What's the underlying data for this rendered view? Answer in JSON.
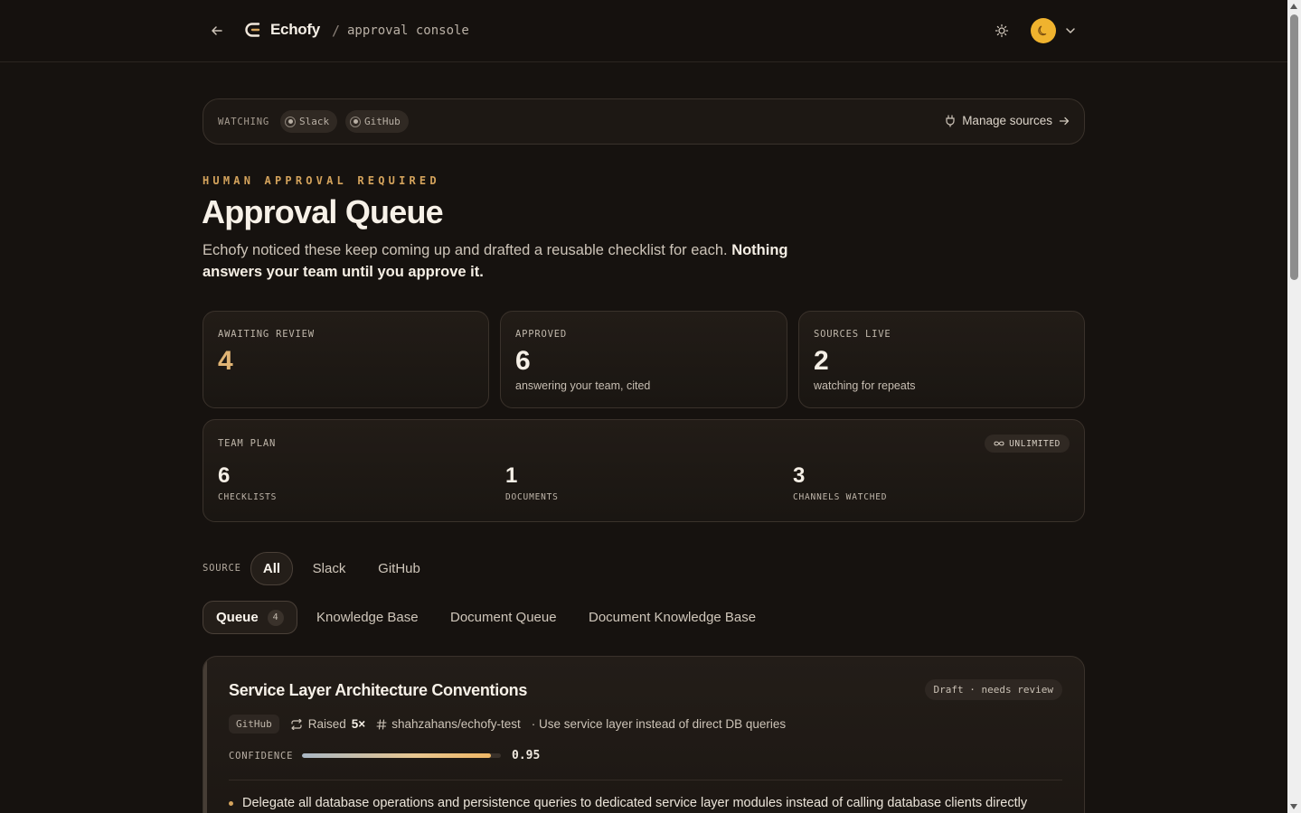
{
  "header": {
    "brand": "Echofy",
    "separator": "/",
    "crumb": "approval console"
  },
  "watching": {
    "label": "WATCHING",
    "sources": [
      "Slack",
      "GitHub"
    ],
    "manage_label": "Manage sources"
  },
  "hero": {
    "eyebrow": "HUMAN APPROVAL REQUIRED",
    "title": "Approval Queue",
    "subtitle_plain": "Echofy noticed these keep coming up and drafted a reusable checklist for each. ",
    "subtitle_bold": "Nothing answers your team until you approve it."
  },
  "stats": [
    {
      "label": "AWAITING REVIEW",
      "value": "4",
      "sub": ""
    },
    {
      "label": "APPROVED",
      "value": "6",
      "sub": "answering your team, cited"
    },
    {
      "label": "SOURCES LIVE",
      "value": "2",
      "sub": "watching for repeats"
    }
  ],
  "plan": {
    "label": "TEAM PLAN",
    "badge": "UNLIMITED",
    "items": [
      {
        "value": "6",
        "caption": "CHECKLISTS"
      },
      {
        "value": "1",
        "caption": "DOCUMENTS"
      },
      {
        "value": "3",
        "caption": "CHANNELS WATCHED"
      }
    ]
  },
  "source_filter": {
    "label": "SOURCE",
    "options": [
      "All",
      "Slack",
      "GitHub"
    ],
    "selected": "All"
  },
  "tabs": {
    "items": [
      "Queue",
      "Knowledge Base",
      "Document Queue",
      "Document Knowledge Base"
    ],
    "queue_count": "4",
    "selected": "Queue"
  },
  "queue_item": {
    "title": "Service Layer Architecture Conventions",
    "status": "Draft · needs review",
    "source": "GitHub",
    "raised_label": "Raised",
    "raised_count": "5×",
    "repo": "shahzahans/echofy-test",
    "summary": "· Use service layer instead of direct DB queries",
    "confidence_label": "CONFIDENCE",
    "confidence": 0.95,
    "confidence_text": "0.95",
    "bullet": "Delegate all database operations and persistence queries to dedicated service layer modules instead of calling database clients directly"
  },
  "colors": {
    "background": "#16120f",
    "accent": "#d4a35c",
    "avatar": "#f0b32e"
  },
  "icons": {
    "back": "arrow-left-icon",
    "logo": "echofy-logo-icon",
    "theme": "sun-icon",
    "avatar": "moon-icon",
    "caret": "chevron-down-icon",
    "manage": "plug-icon",
    "manage_arrow": "arrow-right-icon",
    "unlimited": "infinity-icon",
    "raised": "repeat-icon",
    "repo": "hash-icon"
  }
}
